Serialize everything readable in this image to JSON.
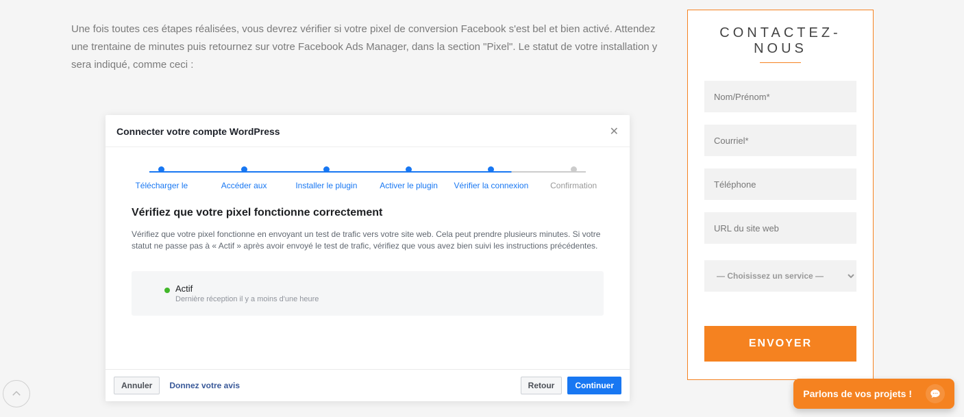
{
  "article": {
    "paragraph": "Une fois toutes ces étapes réalisées, vous devrez vérifier si votre pixel de conversion Facebook s'est bel et bien activé. Attendez une trentaine de minutes puis retournez sur votre Facebook Ads Manager, dans la section \"Pixel\". Le statut de votre installation y sera indiqué, comme ceci :"
  },
  "fb_modal": {
    "title": "Connecter votre compte WordPress",
    "steps": [
      "Télécharger le",
      "Accéder aux",
      "Installer le plugin",
      "Activer le plugin",
      "Vérifier la connexion",
      "Confirmation"
    ],
    "active_step_index": 4,
    "subtitle": "Vérifiez que votre pixel fonctionne correctement",
    "description": "Vérifiez que votre pixel fonctionne en envoyant un test de trafic vers votre site web. Cela peut prendre plusieurs minutes. Si votre statut ne passe pas à « Actif » après avoir envoyé le test de trafic, vérifiez que vous avez bien suivi les instructions précédentes.",
    "status": {
      "label": "Actif",
      "sub": "Dernière réception il y a moins d'une heure"
    },
    "footer": {
      "cancel": "Annuler",
      "feedback": "Donnez votre avis",
      "back": "Retour",
      "continue": "Continuer"
    }
  },
  "sidebar": {
    "title": "CONTACTEZ-NOUS",
    "inputs": {
      "name_placeholder": "Nom/Prénom*",
      "email_placeholder": "Courriel*",
      "phone_placeholder": "Téléphone",
      "url_placeholder": "URL du site web",
      "service_placeholder": "— Choisissez un service —"
    },
    "submit": "ENVOYER"
  },
  "chat_widget": {
    "text": "Parlons de vos projets !"
  }
}
